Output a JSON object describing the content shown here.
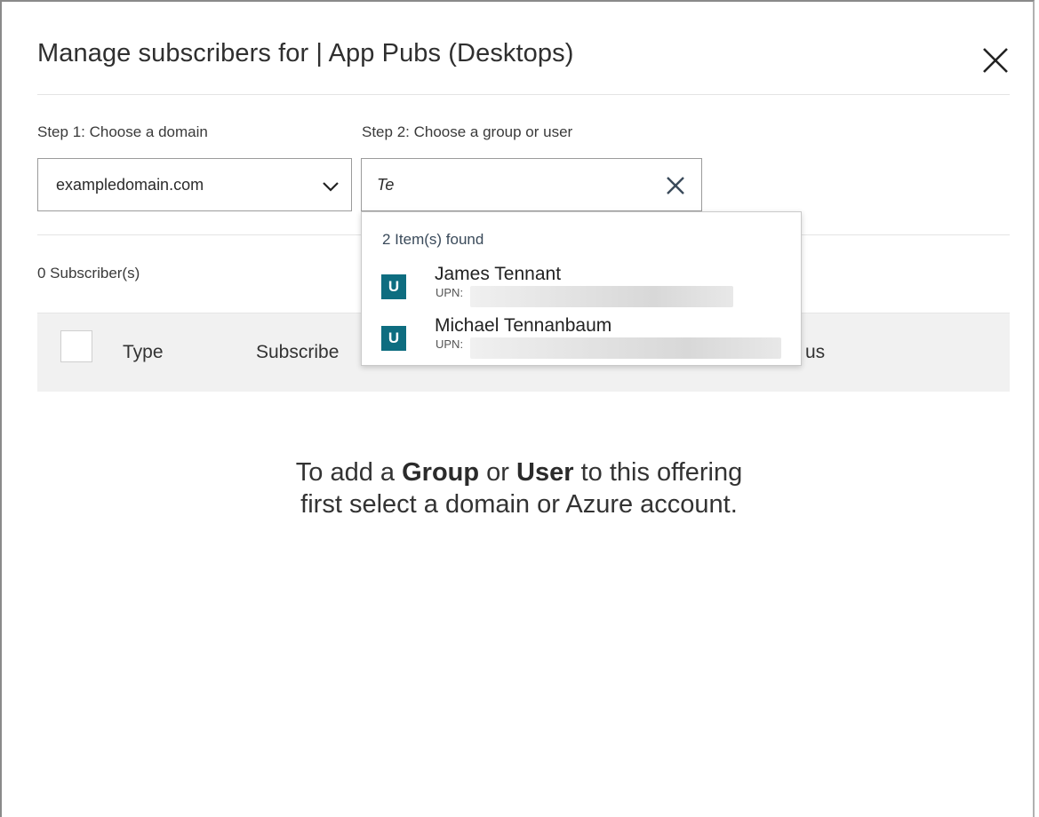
{
  "dialog": {
    "title": "Manage subscribers for | App Pubs (Desktops)",
    "close_icon": "close-icon"
  },
  "step1": {
    "label": "Step 1: Choose a domain",
    "selected_value": "exampledomain.com",
    "icon": "chevron-down-icon"
  },
  "step2": {
    "label": "Step 2: Choose a group or user",
    "value": "Te",
    "clear_icon": "clear-icon"
  },
  "dropdown": {
    "found_text": "2 Item(s) found",
    "results": [
      {
        "badge": "U",
        "name": "James Tennant",
        "upn_label": "UPN:"
      },
      {
        "badge": "U",
        "name": "Michael Tennanbaum",
        "upn_label": "UPN:"
      }
    ]
  },
  "subscribers": {
    "count_text": "0 Subscriber(s)"
  },
  "table": {
    "columns": [
      "Type",
      "Subscribe",
      "us"
    ]
  },
  "empty_state": {
    "line1_pre": "To add a ",
    "line1_group": "Group",
    "line1_mid": " or ",
    "line1_user": "User",
    "line1_post": " to this offering",
    "line2": "first select a domain or Azure account."
  },
  "colors": {
    "badge": "#0e6d80",
    "header_bg": "#f1f1f1"
  }
}
